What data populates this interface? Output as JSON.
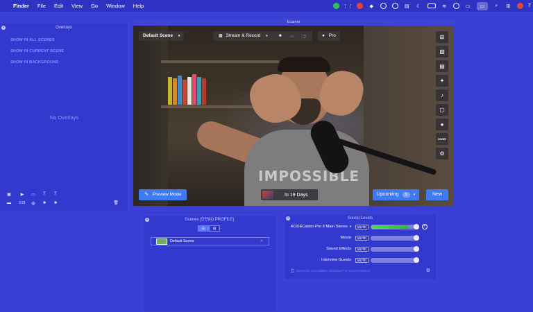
{
  "menubar": {
    "app": "Finder",
    "items": [
      "File",
      "Edit",
      "View",
      "Go",
      "Window",
      "Help"
    ],
    "right_text": "T"
  },
  "overlays": {
    "title": "Overlays",
    "links": [
      "SHOW IN ALL SCENES",
      "SHOW IN CURRENT SCENE",
      "SHOW IN BACKGROUND"
    ],
    "empty": "No Overlays",
    "timer_label": "3:21"
  },
  "ecamm": {
    "title": "Ecamm",
    "scene": "Default Scene",
    "stream_mode": "Stream & Record",
    "pro": "Pro",
    "shirt_text": "IMPOSSIBLE",
    "zoom_label": "zoom",
    "preview_mode": "Preview Mode",
    "event_countdown": "In 19 Days",
    "upcoming_label": "Upcoming",
    "upcoming_count": "3",
    "new_label": "New"
  },
  "scenes": {
    "title": "Scenes (DEMO PROFILE)",
    "items": [
      "Default Scene"
    ]
  },
  "sound": {
    "title": "Sound Levels",
    "rows": [
      {
        "label": "RODECaster Pro II Main Stereo",
        "mute": "MUTE",
        "level": 0.78
      },
      {
        "label": "Movie",
        "mute": "MUTE",
        "level": 0
      },
      {
        "label": "Sound Effects",
        "mute": "MUTE",
        "level": 0
      },
      {
        "label": "Interview Guests",
        "mute": "MUTE",
        "level": 0
      }
    ],
    "footer": "Use Echo Cancellation (Disabled For Current Device)"
  },
  "colors": {
    "desktop": "#3a3fd6",
    "accent": "#3f7af0",
    "meter_green": "#4de14d"
  }
}
